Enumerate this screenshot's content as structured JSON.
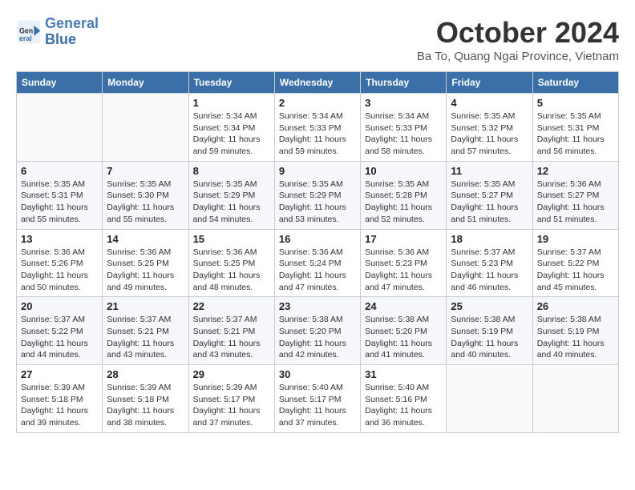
{
  "header": {
    "logo_line1": "General",
    "logo_line2": "Blue",
    "month_title": "October 2024",
    "location": "Ba To, Quang Ngai Province, Vietnam"
  },
  "weekdays": [
    "Sunday",
    "Monday",
    "Tuesday",
    "Wednesday",
    "Thursday",
    "Friday",
    "Saturday"
  ],
  "weeks": [
    [
      {
        "day": "",
        "sunrise": "",
        "sunset": "",
        "daylight": ""
      },
      {
        "day": "",
        "sunrise": "",
        "sunset": "",
        "daylight": ""
      },
      {
        "day": "1",
        "sunrise": "Sunrise: 5:34 AM",
        "sunset": "Sunset: 5:34 PM",
        "daylight": "Daylight: 11 hours and 59 minutes."
      },
      {
        "day": "2",
        "sunrise": "Sunrise: 5:34 AM",
        "sunset": "Sunset: 5:33 PM",
        "daylight": "Daylight: 11 hours and 59 minutes."
      },
      {
        "day": "3",
        "sunrise": "Sunrise: 5:34 AM",
        "sunset": "Sunset: 5:33 PM",
        "daylight": "Daylight: 11 hours and 58 minutes."
      },
      {
        "day": "4",
        "sunrise": "Sunrise: 5:35 AM",
        "sunset": "Sunset: 5:32 PM",
        "daylight": "Daylight: 11 hours and 57 minutes."
      },
      {
        "day": "5",
        "sunrise": "Sunrise: 5:35 AM",
        "sunset": "Sunset: 5:31 PM",
        "daylight": "Daylight: 11 hours and 56 minutes."
      }
    ],
    [
      {
        "day": "6",
        "sunrise": "Sunrise: 5:35 AM",
        "sunset": "Sunset: 5:31 PM",
        "daylight": "Daylight: 11 hours and 55 minutes."
      },
      {
        "day": "7",
        "sunrise": "Sunrise: 5:35 AM",
        "sunset": "Sunset: 5:30 PM",
        "daylight": "Daylight: 11 hours and 55 minutes."
      },
      {
        "day": "8",
        "sunrise": "Sunrise: 5:35 AM",
        "sunset": "Sunset: 5:29 PM",
        "daylight": "Daylight: 11 hours and 54 minutes."
      },
      {
        "day": "9",
        "sunrise": "Sunrise: 5:35 AM",
        "sunset": "Sunset: 5:29 PM",
        "daylight": "Daylight: 11 hours and 53 minutes."
      },
      {
        "day": "10",
        "sunrise": "Sunrise: 5:35 AM",
        "sunset": "Sunset: 5:28 PM",
        "daylight": "Daylight: 11 hours and 52 minutes."
      },
      {
        "day": "11",
        "sunrise": "Sunrise: 5:35 AM",
        "sunset": "Sunset: 5:27 PM",
        "daylight": "Daylight: 11 hours and 51 minutes."
      },
      {
        "day": "12",
        "sunrise": "Sunrise: 5:36 AM",
        "sunset": "Sunset: 5:27 PM",
        "daylight": "Daylight: 11 hours and 51 minutes."
      }
    ],
    [
      {
        "day": "13",
        "sunrise": "Sunrise: 5:36 AM",
        "sunset": "Sunset: 5:26 PM",
        "daylight": "Daylight: 11 hours and 50 minutes."
      },
      {
        "day": "14",
        "sunrise": "Sunrise: 5:36 AM",
        "sunset": "Sunset: 5:25 PM",
        "daylight": "Daylight: 11 hours and 49 minutes."
      },
      {
        "day": "15",
        "sunrise": "Sunrise: 5:36 AM",
        "sunset": "Sunset: 5:25 PM",
        "daylight": "Daylight: 11 hours and 48 minutes."
      },
      {
        "day": "16",
        "sunrise": "Sunrise: 5:36 AM",
        "sunset": "Sunset: 5:24 PM",
        "daylight": "Daylight: 11 hours and 47 minutes."
      },
      {
        "day": "17",
        "sunrise": "Sunrise: 5:36 AM",
        "sunset": "Sunset: 5:23 PM",
        "daylight": "Daylight: 11 hours and 47 minutes."
      },
      {
        "day": "18",
        "sunrise": "Sunrise: 5:37 AM",
        "sunset": "Sunset: 5:23 PM",
        "daylight": "Daylight: 11 hours and 46 minutes."
      },
      {
        "day": "19",
        "sunrise": "Sunrise: 5:37 AM",
        "sunset": "Sunset: 5:22 PM",
        "daylight": "Daylight: 11 hours and 45 minutes."
      }
    ],
    [
      {
        "day": "20",
        "sunrise": "Sunrise: 5:37 AM",
        "sunset": "Sunset: 5:22 PM",
        "daylight": "Daylight: 11 hours and 44 minutes."
      },
      {
        "day": "21",
        "sunrise": "Sunrise: 5:37 AM",
        "sunset": "Sunset: 5:21 PM",
        "daylight": "Daylight: 11 hours and 43 minutes."
      },
      {
        "day": "22",
        "sunrise": "Sunrise: 5:37 AM",
        "sunset": "Sunset: 5:21 PM",
        "daylight": "Daylight: 11 hours and 43 minutes."
      },
      {
        "day": "23",
        "sunrise": "Sunrise: 5:38 AM",
        "sunset": "Sunset: 5:20 PM",
        "daylight": "Daylight: 11 hours and 42 minutes."
      },
      {
        "day": "24",
        "sunrise": "Sunrise: 5:38 AM",
        "sunset": "Sunset: 5:20 PM",
        "daylight": "Daylight: 11 hours and 41 minutes."
      },
      {
        "day": "25",
        "sunrise": "Sunrise: 5:38 AM",
        "sunset": "Sunset: 5:19 PM",
        "daylight": "Daylight: 11 hours and 40 minutes."
      },
      {
        "day": "26",
        "sunrise": "Sunrise: 5:38 AM",
        "sunset": "Sunset: 5:19 PM",
        "daylight": "Daylight: 11 hours and 40 minutes."
      }
    ],
    [
      {
        "day": "27",
        "sunrise": "Sunrise: 5:39 AM",
        "sunset": "Sunset: 5:18 PM",
        "daylight": "Daylight: 11 hours and 39 minutes."
      },
      {
        "day": "28",
        "sunrise": "Sunrise: 5:39 AM",
        "sunset": "Sunset: 5:18 PM",
        "daylight": "Daylight: 11 hours and 38 minutes."
      },
      {
        "day": "29",
        "sunrise": "Sunrise: 5:39 AM",
        "sunset": "Sunset: 5:17 PM",
        "daylight": "Daylight: 11 hours and 37 minutes."
      },
      {
        "day": "30",
        "sunrise": "Sunrise: 5:40 AM",
        "sunset": "Sunset: 5:17 PM",
        "daylight": "Daylight: 11 hours and 37 minutes."
      },
      {
        "day": "31",
        "sunrise": "Sunrise: 5:40 AM",
        "sunset": "Sunset: 5:16 PM",
        "daylight": "Daylight: 11 hours and 36 minutes."
      },
      {
        "day": "",
        "sunrise": "",
        "sunset": "",
        "daylight": ""
      },
      {
        "day": "",
        "sunrise": "",
        "sunset": "",
        "daylight": ""
      }
    ]
  ]
}
